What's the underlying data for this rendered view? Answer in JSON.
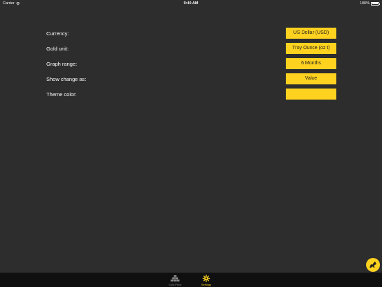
{
  "status_bar": {
    "carrier": "Carrier",
    "time": "9:40 AM",
    "battery": "100%"
  },
  "settings": {
    "rows": [
      {
        "label": "Currency:",
        "value": "US Dollar (USD)"
      },
      {
        "label": "Gold unit:",
        "value": "Troy Ounce (oz t)"
      },
      {
        "label": "Graph range:",
        "value": "6 Months"
      },
      {
        "label": "Show change as:",
        "value": "Value"
      },
      {
        "label": "Theme color:",
        "value": ""
      }
    ]
  },
  "theme": {
    "accent": "#ffd21f",
    "background": "#2d2d2d",
    "tab_bar": "#0f0f0f"
  },
  "tab_bar": {
    "tabs": [
      {
        "label": "Gold Price",
        "icon": "gold-bars-icon",
        "selected": false
      },
      {
        "label": "Settings",
        "icon": "gear-icon",
        "selected": true
      }
    ]
  },
  "fab": {
    "icon": "bull-icon"
  }
}
